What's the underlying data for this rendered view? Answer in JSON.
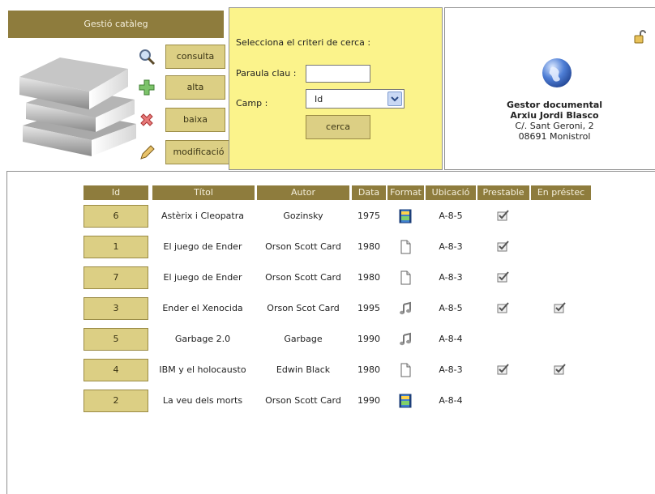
{
  "catalog": {
    "title": "Gestió catàleg",
    "buttons": {
      "consulta": "consulta",
      "alta": "alta",
      "baixa": "baixa",
      "modificacio": "modificació"
    }
  },
  "search": {
    "instructions": "Selecciona el criteri de cerca :",
    "keyword_label": "Paraula clau :",
    "keyword_value": "",
    "field_label": "Camp :",
    "field_value": "Id",
    "search_button": "cerca"
  },
  "info": {
    "line1": "Gestor documental",
    "line2": "Arxiu Jordi Blasco",
    "line3": "C/. Sant Geroni, 2",
    "line4": "08691 Monistrol"
  },
  "table": {
    "headers": [
      "Id",
      "Títol",
      "Autor",
      "Data",
      "Format",
      "Ubicació",
      "Prestable",
      "En préstec"
    ],
    "rows": [
      {
        "id": "6",
        "title": "Astèrix i Cleopatra",
        "author": "Gozinsky",
        "date": "1975",
        "format": "video",
        "location": "A-8-5",
        "lendable": true,
        "on_loan": false
      },
      {
        "id": "1",
        "title": "El juego de Ender",
        "author": "Orson Scott Card",
        "date": "1980",
        "format": "document",
        "location": "A-8-3",
        "lendable": true,
        "on_loan": false
      },
      {
        "id": "7",
        "title": "El juego de Ender",
        "author": "Orson Scott Card",
        "date": "1980",
        "format": "document",
        "location": "A-8-3",
        "lendable": true,
        "on_loan": false
      },
      {
        "id": "3",
        "title": "Ender el Xenocida",
        "author": "Orson Scot Card",
        "date": "1995",
        "format": "audio",
        "location": "A-8-5",
        "lendable": true,
        "on_loan": true
      },
      {
        "id": "5",
        "title": "Garbage 2.0",
        "author": "Garbage",
        "date": "1990",
        "format": "audio",
        "location": "A-8-4",
        "lendable": false,
        "on_loan": false
      },
      {
        "id": "4",
        "title": "IBM y el holocausto",
        "author": "Edwin Black",
        "date": "1980",
        "format": "document",
        "location": "A-8-3",
        "lendable": true,
        "on_loan": true
      },
      {
        "id": "2",
        "title": "La veu dels morts",
        "author": "Orson Scott Card",
        "date": "1990",
        "format": "video",
        "location": "A-8-4",
        "lendable": false,
        "on_loan": false
      }
    ]
  },
  "colors": {
    "header_bg": "#8e7c3d",
    "button_bg": "#dccf84",
    "search_panel_bg": "#fbf38b"
  }
}
